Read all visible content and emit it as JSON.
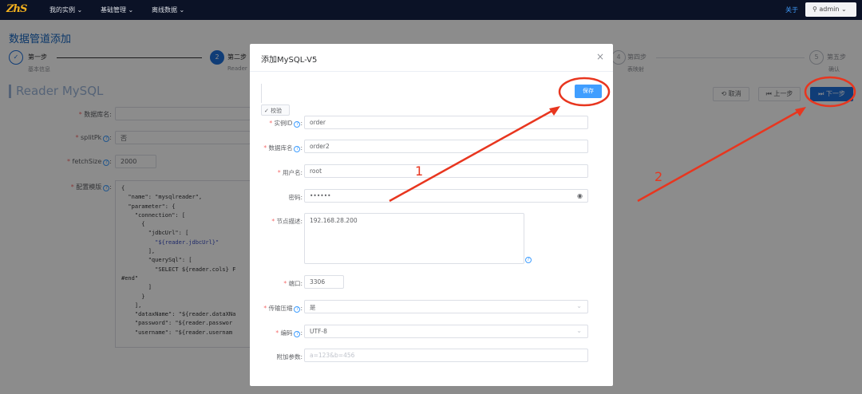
{
  "topbar": {
    "logo": "ZhS",
    "nav": [
      "我的实例 ⌄",
      "基础管理 ⌄",
      "离线数据 ⌄"
    ],
    "about": "关于",
    "user": "admin ⌄"
  },
  "page": {
    "title": "数据管道添加",
    "steps": [
      {
        "num": "✓",
        "title": "第一步",
        "desc": "基本信息"
      },
      {
        "num": "2",
        "title": "第二步",
        "desc": "Reader"
      },
      {
        "num": "4",
        "title": "第四步",
        "desc": "表映射"
      },
      {
        "num": "5",
        "title": "第五步",
        "desc": "确认"
      }
    ],
    "section_title": "Reader MySQL",
    "buttons": {
      "cancel": "取消",
      "prev": "上一步",
      "next": "下一步"
    },
    "form": {
      "db_label": "数据库名",
      "splitpk_label": "splitPk",
      "splitpk_value": "否",
      "fetchsize_label": "fetchSize",
      "fetchsize_value": "2000",
      "template_label": "配置模版"
    },
    "template_lines": [
      "{",
      "  \"name\": \"mysqlreader\",",
      "  \"parameter\": {",
      "    \"connection\": [",
      "      {",
      "        \"jdbcUrl\": [",
      "          \"${reader.jdbcUrl}\"",
      "        ],",
      "        \"querySql\": [",
      "          \"SELECT ${reader.cols} F",
      "#end\"",
      "        ]",
      "      }",
      "    ],",
      "    \"dataxName\": \"${reader.dataXNa",
      "    \"password\": \"${reader.passwor",
      "    \"username\": \"${reader.usernam"
    ]
  },
  "modal": {
    "title": "添加MySQL-V5",
    "close": "×",
    "save": "保存",
    "verify": "校验",
    "fields": {
      "instance_id": {
        "label": "实例ID",
        "value": "order"
      },
      "db_name": {
        "label": "数据库名",
        "value": "order2"
      },
      "username": {
        "label": "用户名",
        "value": "root"
      },
      "password": {
        "label": "密码",
        "value": "••••••"
      },
      "node_desc": {
        "label": "节点描述",
        "value": "192.168.28.200"
      },
      "port": {
        "label": "端口",
        "value": "3306"
      },
      "compress": {
        "label": "传输压缩",
        "value": "是"
      },
      "encoding": {
        "label": "编码",
        "value": "UTF-8"
      },
      "extra": {
        "label": "附加参数",
        "placeholder": "a=123&b=456"
      }
    }
  },
  "annotations": {
    "one": "1",
    "two": "2"
  },
  "colors": {
    "accent": "#1e6fd9",
    "annotation": "#e8361f",
    "topbar": "#0b1226"
  }
}
